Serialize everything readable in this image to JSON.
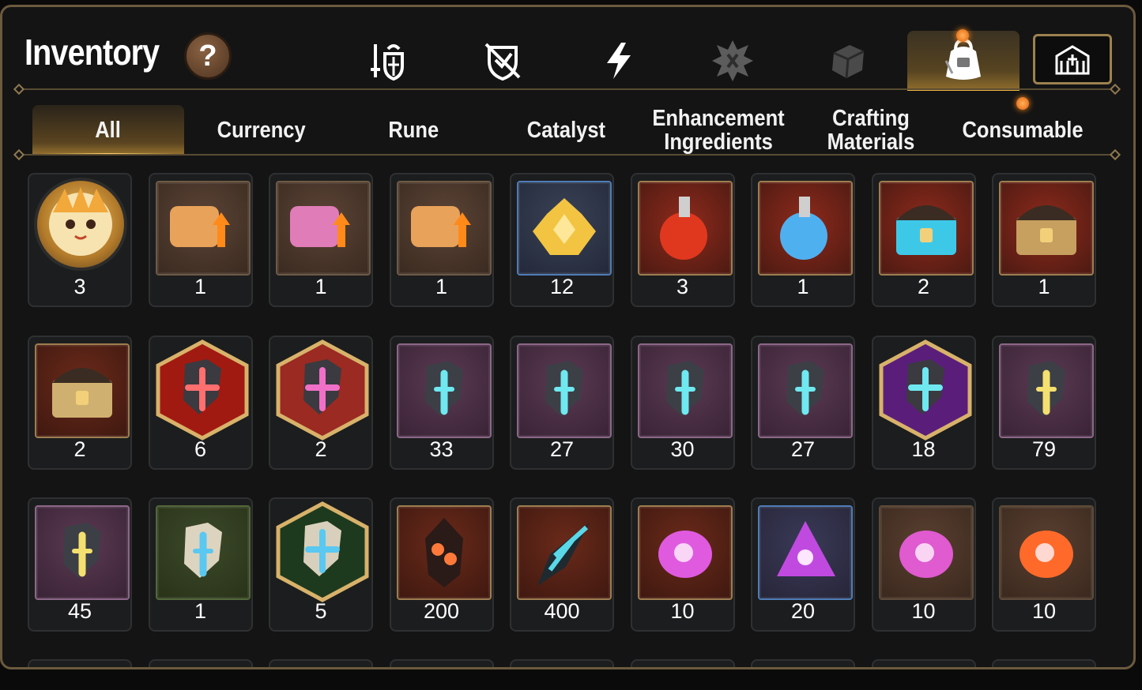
{
  "header": {
    "title": "Inventory",
    "help_label": "?",
    "category_icons": [
      {
        "name": "weapon-armor-icon",
        "active": false
      },
      {
        "name": "shield-off-icon",
        "active": false
      },
      {
        "name": "lightning-icon",
        "active": false
      },
      {
        "name": "emblem-icon",
        "active": false
      },
      {
        "name": "gem-icon",
        "active": false
      },
      {
        "name": "bag-icon",
        "active": true
      },
      {
        "name": "castle-icon",
        "active": false
      }
    ]
  },
  "tabs": [
    {
      "label": "All",
      "active": true
    },
    {
      "label": "Currency",
      "active": false
    },
    {
      "label": "Rune",
      "active": false
    },
    {
      "label": "Catalyst",
      "active": false
    },
    {
      "label": "Enhancement Ingredients",
      "active": false
    },
    {
      "label": "Crafting Materials",
      "active": false
    },
    {
      "label": "Consumable",
      "active": false
    }
  ],
  "items": [
    [
      {
        "icon": "character-portrait-icon",
        "qty": "3"
      },
      {
        "icon": "scroll-upgrade-icon",
        "qty": "1"
      },
      {
        "icon": "rainbow-scroll-upgrade-icon",
        "qty": "1"
      },
      {
        "icon": "scroll-upgrade-icon",
        "qty": "1"
      },
      {
        "icon": "gold-crystal-cluster-icon",
        "qty": "12"
      },
      {
        "icon": "red-potion-icon",
        "qty": "3"
      },
      {
        "icon": "blue-star-potion-icon",
        "qty": "1"
      },
      {
        "icon": "blue-chest-icon",
        "qty": "2"
      },
      {
        "icon": "treasure-chest-icon",
        "qty": "1"
      }
    ],
    [
      {
        "icon": "black-chest-icon",
        "qty": "2"
      },
      {
        "icon": "red-rune-hex-icon",
        "qty": "6"
      },
      {
        "icon": "pink-potion-hex-icon",
        "qty": "2"
      },
      {
        "icon": "sword-rune-icon",
        "qty": "33"
      },
      {
        "icon": "helmet-rune-icon",
        "qty": "27"
      },
      {
        "icon": "armor-rune-icon",
        "qty": "30"
      },
      {
        "icon": "boot-rune-icon",
        "qty": "27"
      },
      {
        "icon": "purple-rune-hex-icon",
        "qty": "18"
      },
      {
        "icon": "hammer-rune-icon",
        "qty": "79"
      }
    ],
    [
      {
        "icon": "yellow-rune-icon",
        "qty": "45"
      },
      {
        "icon": "stone-sword-rune-icon",
        "qty": "1"
      },
      {
        "icon": "stone-rune-hex-icon",
        "qty": "5"
      },
      {
        "icon": "fire-crystal-icon",
        "qty": "200"
      },
      {
        "icon": "ice-shard-icon",
        "qty": "400"
      },
      {
        "icon": "purple-moon-gem-icon",
        "qty": "10"
      },
      {
        "icon": "purple-triangle-gem-icon",
        "qty": "20"
      },
      {
        "icon": "moon-orb-icon",
        "qty": "10"
      },
      {
        "icon": "fire-orb-icon",
        "qty": "10"
      }
    ]
  ],
  "colors": {
    "accent": "#f0b840",
    "frame": "#6b5a3e",
    "notification": "#ff8b1c"
  }
}
